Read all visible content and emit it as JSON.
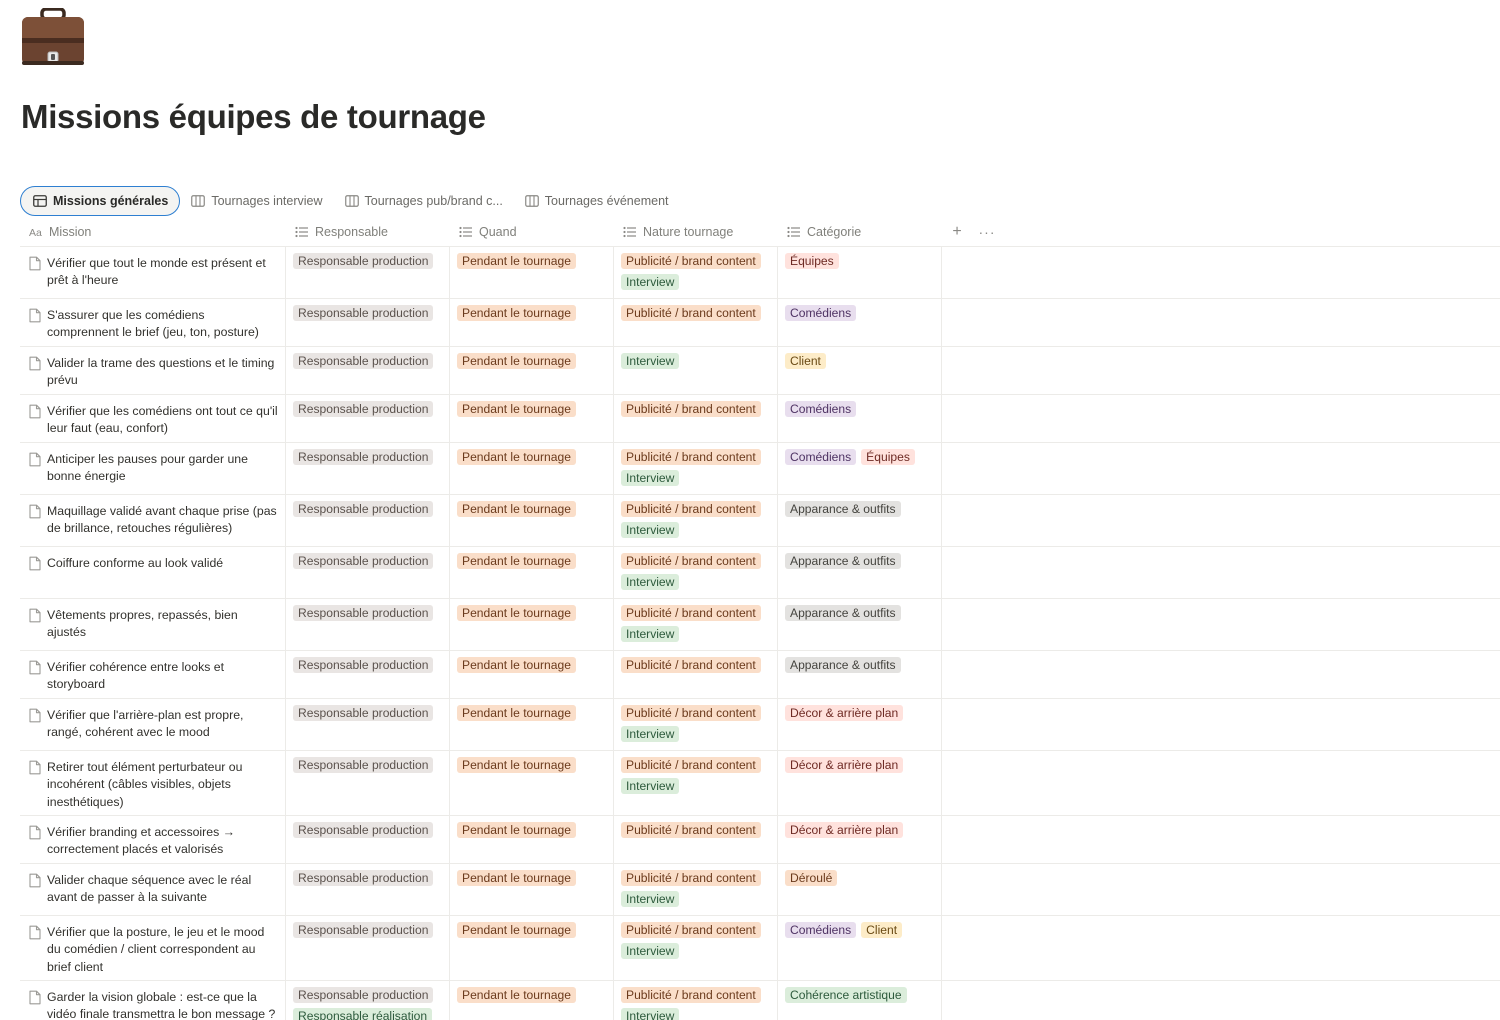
{
  "page": {
    "icon": "briefcase-icon",
    "title": "Missions équipes de tournage"
  },
  "tabs": [
    {
      "label": "Missions générales",
      "icon": "table-icon",
      "active": true
    },
    {
      "label": "Tournages interview",
      "icon": "board-icon",
      "active": false
    },
    {
      "label": "Tournages pub/brand c...",
      "icon": "board-icon",
      "active": false
    },
    {
      "label": "Tournages événement",
      "icon": "board-icon",
      "active": false
    }
  ],
  "columns": {
    "mission": "Mission",
    "responsable": "Responsable",
    "quand": "Quand",
    "nature": "Nature tournage",
    "categorie": "Catégorie",
    "add": "+",
    "more": "···"
  },
  "tag_colors": {
    "Responsable production": "#e9e5e3",
    "Responsable réalisation": "#dbeddb",
    "Pendant le tournage": "#fadec9",
    "Publicité / brand content": "#fadec9",
    "Interview": "#dbeddb",
    "Équipes": "#ffe2dd",
    "Comédiens": "#e8deee",
    "Client": "#fdecc8",
    "Apparance & outfits": "#e3e2e0",
    "Décor & arrière plan": "#ffe2dd",
    "Déroulé": "#fadec9",
    "Cohérence artistique": "#dbeddb"
  },
  "rows": [
    {
      "mission": "Vérifier que tout le monde est présent et prêt à l'heure",
      "responsable": [
        "Responsable production"
      ],
      "quand": [
        "Pendant le tournage"
      ],
      "nature": [
        "Publicité / brand content",
        "Interview"
      ],
      "categorie": [
        "Équipes"
      ]
    },
    {
      "mission": "S'assurer que les comédiens comprennent le brief (jeu, ton, posture)",
      "responsable": [
        "Responsable production"
      ],
      "quand": [
        "Pendant le tournage"
      ],
      "nature": [
        "Publicité / brand content"
      ],
      "categorie": [
        "Comédiens"
      ]
    },
    {
      "mission": "Valider la trame des questions et le timing prévu",
      "responsable": [
        "Responsable production"
      ],
      "quand": [
        "Pendant le tournage"
      ],
      "nature": [
        "Interview"
      ],
      "categorie": [
        "Client"
      ]
    },
    {
      "mission": "Vérifier que les comédiens ont tout ce qu'il leur faut (eau, confort)",
      "responsable": [
        "Responsable production"
      ],
      "quand": [
        "Pendant le tournage"
      ],
      "nature": [
        "Publicité / brand content"
      ],
      "categorie": [
        "Comédiens"
      ]
    },
    {
      "mission": "Anticiper les pauses pour garder une bonne énergie",
      "responsable": [
        "Responsable production"
      ],
      "quand": [
        "Pendant le tournage"
      ],
      "nature": [
        "Publicité / brand content",
        "Interview"
      ],
      "categorie": [
        "Comédiens",
        "Équipes"
      ]
    },
    {
      "mission": "Maquillage validé avant chaque prise (pas de brillance, retouches régulières)",
      "responsable": [
        "Responsable production"
      ],
      "quand": [
        "Pendant le tournage"
      ],
      "nature": [
        "Publicité / brand content",
        "Interview"
      ],
      "categorie": [
        "Apparance & outfits"
      ]
    },
    {
      "mission": "Coiffure conforme au look validé",
      "responsable": [
        "Responsable production"
      ],
      "quand": [
        "Pendant le tournage"
      ],
      "nature": [
        "Publicité / brand content",
        "Interview"
      ],
      "categorie": [
        "Apparance & outfits"
      ]
    },
    {
      "mission": "Vêtements propres, repassés, bien ajustés",
      "responsable": [
        "Responsable production"
      ],
      "quand": [
        "Pendant le tournage"
      ],
      "nature": [
        "Publicité / brand content",
        "Interview"
      ],
      "categorie": [
        "Apparance & outfits"
      ]
    },
    {
      "mission": "Vérifier cohérence entre looks et storyboard",
      "responsable": [
        "Responsable production"
      ],
      "quand": [
        "Pendant le tournage"
      ],
      "nature": [
        "Publicité / brand content"
      ],
      "categorie": [
        "Apparance & outfits"
      ]
    },
    {
      "mission": "Vérifier que l'arrière-plan est propre, rangé, cohérent avec le mood",
      "responsable": [
        "Responsable production"
      ],
      "quand": [
        "Pendant le tournage"
      ],
      "nature": [
        "Publicité / brand content",
        "Interview"
      ],
      "categorie": [
        "Décor & arrière plan"
      ]
    },
    {
      "mission": "Retirer tout élément perturbateur ou incohérent (câbles visibles, objets inesthétiques)",
      "responsable": [
        "Responsable production"
      ],
      "quand": [
        "Pendant le tournage"
      ],
      "nature": [
        "Publicité / brand content",
        "Interview"
      ],
      "categorie": [
        "Décor & arrière plan"
      ]
    },
    {
      "mission": "Vérifier branding et accessoires → correctement placés et valorisés",
      "responsable": [
        "Responsable production"
      ],
      "quand": [
        "Pendant le tournage"
      ],
      "nature": [
        "Publicité / brand content"
      ],
      "categorie": [
        "Décor & arrière plan"
      ]
    },
    {
      "mission": "Valider chaque séquence avec le réal avant de passer à la suivante",
      "responsable": [
        "Responsable production"
      ],
      "quand": [
        "Pendant le tournage"
      ],
      "nature": [
        "Publicité / brand content",
        "Interview"
      ],
      "categorie": [
        "Déroulé"
      ]
    },
    {
      "mission": "Vérifier que la posture, le jeu et le mood du comédien / client correspondent au brief client",
      "responsable": [
        "Responsable production"
      ],
      "quand": [
        "Pendant le tournage"
      ],
      "nature": [
        "Publicité / brand content",
        "Interview"
      ],
      "categorie": [
        "Comédiens",
        "Client"
      ]
    },
    {
      "mission": "Garder la vision globale : est-ce que la vidéo finale transmettra le bon message ?",
      "responsable": [
        "Responsable production",
        "Responsable réalisation"
      ],
      "quand": [
        "Pendant le tournage"
      ],
      "nature": [
        "Publicité / brand content",
        "Interview"
      ],
      "categorie": [
        "Cohérence artistique"
      ]
    }
  ]
}
